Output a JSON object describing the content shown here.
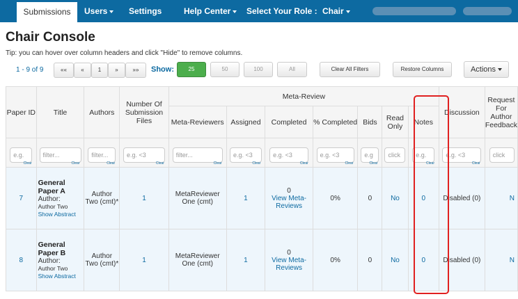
{
  "nav": {
    "submissions": "Submissions",
    "users": "Users",
    "settings": "Settings",
    "help_center": "Help Center",
    "role_label": "Select Your Role :",
    "role_value": "Chair"
  },
  "page_title": "Chair Console",
  "tip": "Tip: you can hover over column headers and click \"Hide\" to remove columns.",
  "pager": {
    "info": "1 - 9 of 9",
    "first": "««",
    "prev": "«",
    "page": "1",
    "next": "»",
    "last": "»»"
  },
  "show": {
    "label": "Show:",
    "options": [
      "25",
      "50",
      "100",
      "All"
    ],
    "selected": "25"
  },
  "buttons": {
    "clear_filters": "Clear All Filters",
    "restore_columns": "Restore Columns",
    "actions": "Actions"
  },
  "table": {
    "group_header": "Meta-Review",
    "headers": {
      "paper_id": "Paper ID",
      "title": "Title",
      "authors": "Authors",
      "num_files": "Number Of Submission Files",
      "meta_reviewers": "Meta-Reviewers",
      "assigned": "Assigned",
      "completed": "Completed",
      "pct_completed": "% Completed",
      "bids": "Bids",
      "read_only": "Read Only",
      "notes": "Notes",
      "discussion": "Discussion",
      "request": "Request For Author Feedback"
    },
    "filters": {
      "paper_id": "e.g.",
      "title": "filter...",
      "authors": "filter...",
      "num_files": "e.g. <3",
      "meta_reviewers": "filter...",
      "assigned": "e.g. <3",
      "completed": "e.g. <3",
      "pct_completed": "e.g. <3",
      "bids": "e.g",
      "read_only": "click",
      "notes": "e.g.",
      "discussion": "e.g. <3",
      "request": "click",
      "clear": "Clear"
    },
    "rows": [
      {
        "paper_id": "7",
        "title": "General Paper A",
        "author_label": "Author:",
        "author_name": "Author Two",
        "show_abstract": "Show Abstract",
        "authors": "Author Two (cmt)*",
        "num_files": "1",
        "meta_reviewers": "MetaReviewer One (cmt)",
        "assigned": "1",
        "completed_count": "0",
        "completed_link": "View Meta-Reviews",
        "pct_completed": "0%",
        "bids": "0",
        "read_only": "No",
        "notes": "0",
        "discussion": "Disabled (0)"
      },
      {
        "paper_id": "8",
        "title": "General Paper B",
        "author_label": "Author:",
        "author_name": "Author Two",
        "show_abstract": "Show Abstract",
        "authors": "Author Two (cmt)*",
        "num_files": "1",
        "meta_reviewers": "MetaReviewer One (cmt)",
        "assigned": "1",
        "completed_count": "0",
        "completed_link": "View Meta-Reviews",
        "pct_completed": "0%",
        "bids": "0",
        "read_only": "No",
        "notes": "0",
        "discussion": "Disabled (0)"
      }
    ]
  },
  "colors": {
    "navbar": "#0d6aa1",
    "link": "#0d6aa1",
    "active_show": "#4cae4c",
    "highlight": "#e02020",
    "row_bg": "#eef6fc"
  }
}
